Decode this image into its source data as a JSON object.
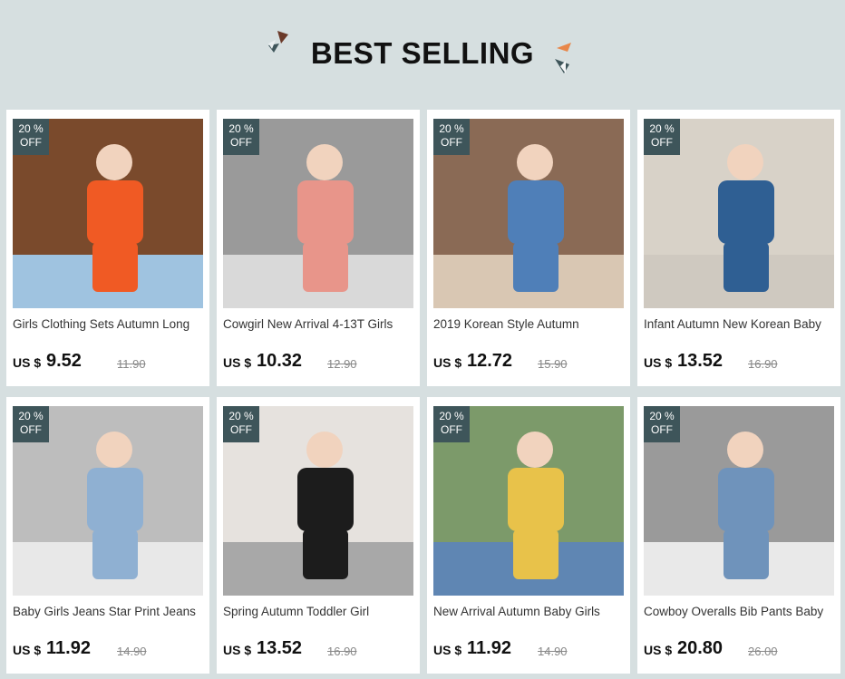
{
  "header": {
    "title": "BEST SELLING"
  },
  "badge": {
    "line1": "20 %",
    "line2": "OFF"
  },
  "colors": {
    "background": "#d6dfe0",
    "badge": "#3e555a",
    "card": "#ffffff"
  },
  "products": [
    {
      "name": "Girls Clothing Sets Autumn Long",
      "currency": "US $",
      "price": "9.52",
      "old_price": "11.90",
      "img": [
        "#7a4a2c",
        "#f05a24",
        "#9fc3e0"
      ]
    },
    {
      "name": "Cowgirl New Arrival 4-13T Girls",
      "currency": "US $",
      "price": "10.32",
      "old_price": "12.90",
      "img": [
        "#9a9a9a",
        "#e8958a",
        "#d9d9d9"
      ]
    },
    {
      "name": "2019 Korean Style Autumn",
      "currency": "US $",
      "price": "12.72",
      "old_price": "15.90",
      "img": [
        "#8a6a55",
        "#4f7fb8",
        "#d9c7b3"
      ]
    },
    {
      "name": "Infant Autumn New Korean Baby",
      "currency": "US $",
      "price": "13.52",
      "old_price": "16.90",
      "img": [
        "#d8d2c8",
        "#2f5f93",
        "#cfc9c0"
      ]
    },
    {
      "name": "Baby Girls Jeans Star Print Jeans",
      "currency": "US $",
      "price": "11.92",
      "old_price": "14.90",
      "img": [
        "#bdbdbd",
        "#8fb0d2",
        "#e8e8e8"
      ]
    },
    {
      "name": "Spring Autumn Toddler Girl",
      "currency": "US $",
      "price": "13.52",
      "old_price": "16.90",
      "img": [
        "#e6e2de",
        "#1c1c1c",
        "#a8a8a8"
      ]
    },
    {
      "name": "New Arrival Autumn Baby Girls",
      "currency": "US $",
      "price": "11.92",
      "old_price": "14.90",
      "img": [
        "#7c9a6a",
        "#e8c24a",
        "#5f86b3"
      ]
    },
    {
      "name": "Cowboy Overalls Bib Pants Baby",
      "currency": "US $",
      "price": "20.80",
      "old_price": "26.00",
      "img": [
        "#9a9a9a",
        "#6f93bb",
        "#e9e9e9"
      ]
    }
  ]
}
